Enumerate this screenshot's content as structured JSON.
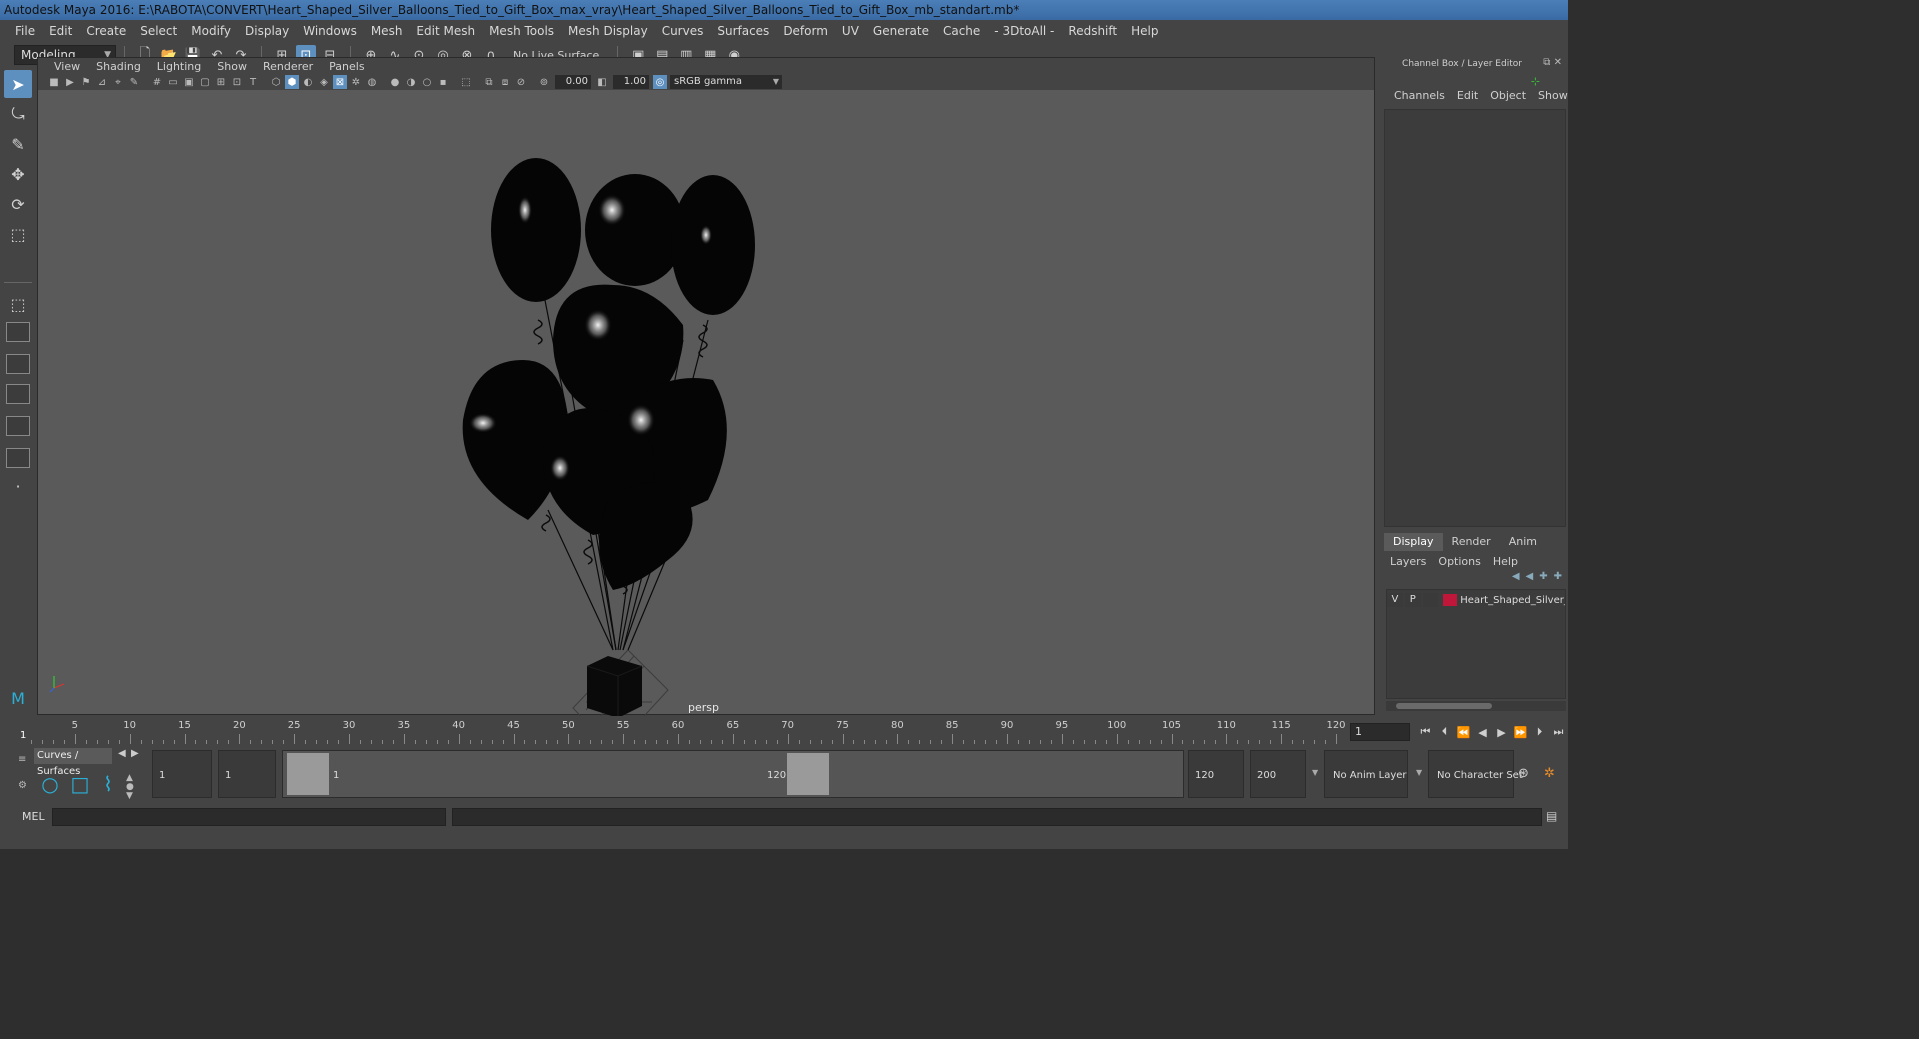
{
  "window": {
    "title": "Autodesk Maya 2016: E:\\RABOTA\\CONVERT\\Heart_Shaped_Silver_Balloons_Tied_to_Gift_Box_max_vray\\Heart_Shaped_Silver_Balloons_Tied_to_Gift_Box_mb_standart.mb*",
    "minimize": "—",
    "maximize": "□",
    "close": "✕"
  },
  "menubar": [
    "File",
    "Edit",
    "Create",
    "Select",
    "Modify",
    "Display",
    "Windows",
    "Mesh",
    "Edit Mesh",
    "Mesh Tools",
    "Mesh Display",
    "Curves",
    "Surfaces",
    "Deform",
    "UV",
    "Generate",
    "Cache",
    "- 3DtoAll -",
    "Redshift",
    "Help"
  ],
  "statusline": {
    "mode": "Modeling",
    "live_surface": "No Live Surface"
  },
  "viewport": {
    "menu": [
      "View",
      "Shading",
      "Lighting",
      "Show",
      "Renderer",
      "Panels"
    ],
    "exposure": "0.00",
    "gamma_value": "1.00",
    "color_space": "sRGB gamma",
    "camera_label": "persp"
  },
  "channel_box": {
    "title": "Channel Box / Layer Editor",
    "menu": [
      "Channels",
      "Edit",
      "Object",
      "Show"
    ]
  },
  "layer_editor": {
    "tabs": [
      "Display",
      "Render",
      "Anim"
    ],
    "active_tab": "Display",
    "menu": [
      "Layers",
      "Options",
      "Help"
    ],
    "layers": [
      {
        "v": "V",
        "p": "P",
        "name": "Heart_Shaped_Silver_Bal",
        "color": "#c0163a"
      }
    ]
  },
  "time_slider": {
    "ticks": [
      "5",
      "10",
      "15",
      "20",
      "25",
      "30",
      "35",
      "40",
      "45",
      "50",
      "55",
      "60",
      "65",
      "70",
      "75",
      "80",
      "85",
      "90",
      "95",
      "100",
      "105",
      "110",
      "115",
      "120"
    ],
    "current_frame_label": "1",
    "current_frame_field": "1"
  },
  "range_slider": {
    "shelf_tab": "Curves / Surfaces",
    "start_time": "1",
    "playback_start": "1",
    "range_start_label": "1",
    "range_end_label": "120",
    "playback_end": "120",
    "end_time": "200",
    "anim_layer": "No Anim Layer",
    "character_set": "No Character Set"
  },
  "command_line": {
    "label": "MEL"
  }
}
